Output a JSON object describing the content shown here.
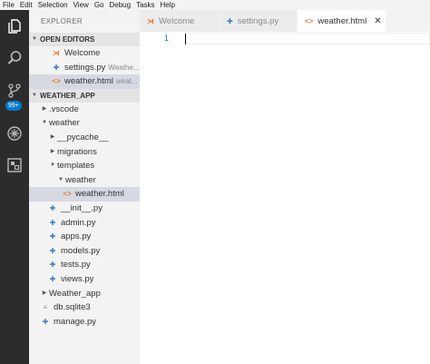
{
  "menu": [
    "File",
    "Edit",
    "Selection",
    "View",
    "Go",
    "Debug",
    "Tasks",
    "Help"
  ],
  "activity": {
    "scm_badge": "99+"
  },
  "sidebar": {
    "title": "EXPLORER",
    "open_editors_label": "OPEN EDITORS",
    "open_editors": [
      {
        "name": "Welcome",
        "icon": "vs-logo-icon"
      },
      {
        "name": "settings.py",
        "hint": "Weathe...",
        "icon": "python-icon"
      },
      {
        "name": "weather.html",
        "hint": "weat...",
        "icon": "html-icon"
      }
    ],
    "project_label": "WEATHER_APP",
    "tree": [
      {
        "name": ".vscode",
        "twist": "right"
      },
      {
        "name": "weather",
        "twist": "down"
      },
      {
        "name": "__pycache__",
        "twist": "right"
      },
      {
        "name": "migrations",
        "twist": "right"
      },
      {
        "name": "templates",
        "twist": "down"
      },
      {
        "name": "weather",
        "twist": "down"
      },
      {
        "name": "weather.html",
        "icon": "html-icon"
      },
      {
        "name": "__init__.py",
        "icon": "python-icon"
      },
      {
        "name": "admin.py",
        "icon": "python-icon"
      },
      {
        "name": "apps.py",
        "icon": "python-icon"
      },
      {
        "name": "models.py",
        "icon": "python-icon"
      },
      {
        "name": "tests.py",
        "icon": "python-icon"
      },
      {
        "name": "views.py",
        "icon": "python-icon"
      },
      {
        "name": "Weather_app",
        "twist": "right"
      },
      {
        "name": "db.sqlite3",
        "icon": "file-icon"
      },
      {
        "name": "manage.py",
        "icon": "python-icon"
      }
    ]
  },
  "tabs": [
    {
      "label": "Welcome",
      "icon": "vs-logo-icon"
    },
    {
      "label": "settings.py",
      "icon": "python-icon"
    },
    {
      "label": "weather.html",
      "icon": "html-icon",
      "active": true,
      "close": "✕"
    }
  ],
  "editor": {
    "line_number": "1"
  }
}
